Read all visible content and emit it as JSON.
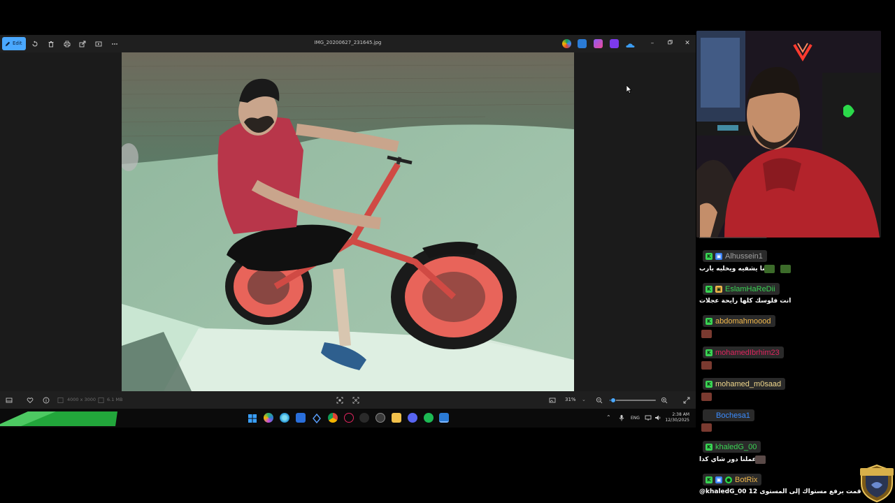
{
  "viewer": {
    "edit_label": "Edit",
    "file_name": "IMG_20200627_231645.jpg",
    "dimensions": "4000 x 3000",
    "file_size": "6.1 MB",
    "zoom": "31%",
    "zoom_level": 0.08
  },
  "taskbar": {
    "language": "ENG",
    "time": "2:38 AM",
    "date": "12/30/2025"
  },
  "chat": {
    "messages": [
      {
        "user": "Alhussein1",
        "color": "#a0a0a0",
        "text": "ربنا يشفيه ويخليه يارب"
      },
      {
        "user": "EslamHaReDii",
        "color": "#39d353",
        "text": "انت فلوسك كلها رايحة عجلات"
      },
      {
        "user": "abdomahmoood",
        "color": "#f2b84b",
        "text": ""
      },
      {
        "user": "mohamedIbrhim23",
        "color": "#e0245e",
        "text": ""
      },
      {
        "user": "mohamed_m0saad",
        "color": "#f0d78c",
        "text": ""
      },
      {
        "user": "Bochesa1",
        "color": "#3c8dff",
        "text": ""
      },
      {
        "user": "khaledG_00",
        "color": "#39d353",
        "text": "اعملنا دور شاي كدا"
      },
      {
        "user": "BotRix",
        "color": "#f2b84b",
        "text": "@khaledG_00 قمت برفع مستواك إلى المستوى 12"
      }
    ]
  },
  "icons": {
    "kick_badge": "kick-badge-icon",
    "sub_badge": "subscriber-badge-icon"
  }
}
